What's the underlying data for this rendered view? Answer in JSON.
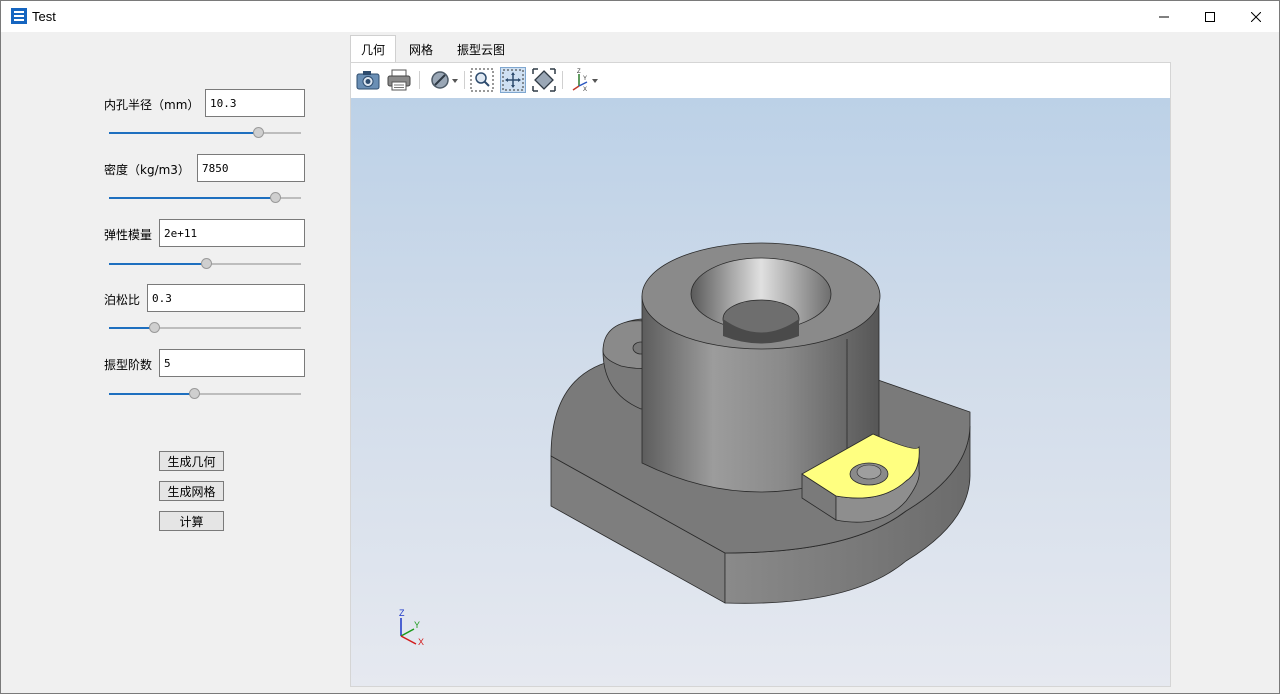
{
  "window": {
    "title": "Test"
  },
  "params": [
    {
      "label": "内孔半径（mm）",
      "value": "10.3",
      "slider": 0.78
    },
    {
      "label": "密度（kg/m3）",
      "value": "7850",
      "slider": 0.87
    },
    {
      "label": "弹性模量",
      "value": "2e+11",
      "slider": 0.51
    },
    {
      "label": "泊松比",
      "value": "0.3",
      "slider": 0.24
    },
    {
      "label": "振型阶数",
      "value": "5",
      "slider": 0.45
    }
  ],
  "buttons": {
    "geometry": "生成几何",
    "mesh": "生成网格",
    "compute": "计算"
  },
  "tabs": [
    "几何",
    "网格",
    "振型云图"
  ],
  "active_tab": 0,
  "toolbar": [
    "camera-icon",
    "print-icon",
    "display-mode-icon",
    "zoom-window-icon",
    "pan-icon",
    "fit-all-icon",
    "view-axes-icon"
  ],
  "triad": {
    "z": "Z",
    "y": "Y",
    "x": "X"
  },
  "colors": {
    "selected_face": "#ffff80",
    "solid": "#8c8c8c",
    "slider_fill": "#1e6fbf"
  }
}
